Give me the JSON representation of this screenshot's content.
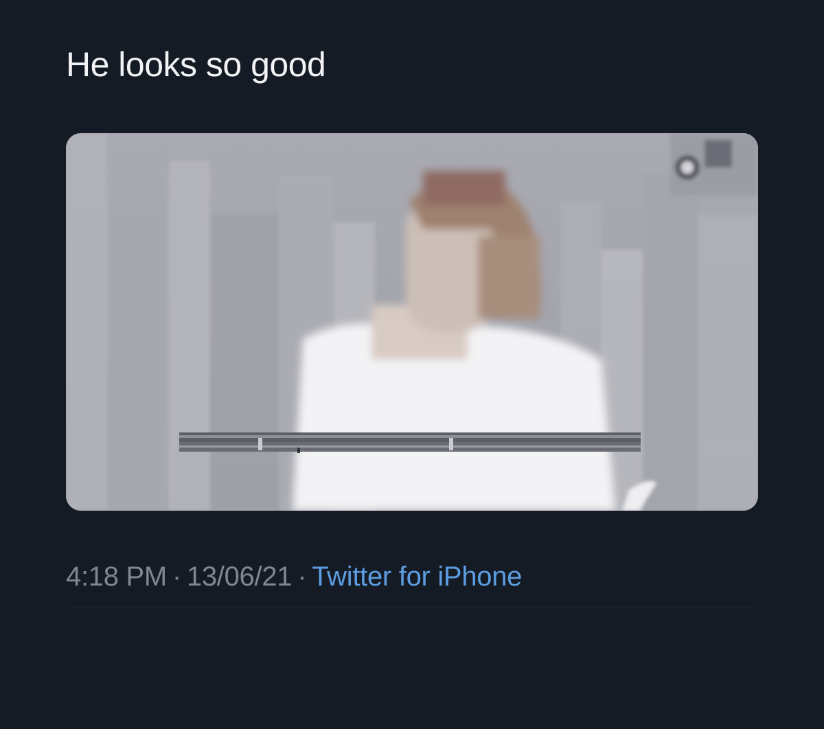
{
  "tweet": {
    "text": "He looks so good",
    "media": {
      "type": "video-still",
      "description_icon": "blurred-video-frame"
    },
    "meta": {
      "time": "4:18 PM",
      "separator": "·",
      "date": "13/06/21",
      "source": "Twitter for iPhone"
    }
  },
  "colors": {
    "background": "#151b25",
    "text": "#f2f3f5",
    "meta": "#7f8891",
    "link": "#5c9ce0"
  }
}
